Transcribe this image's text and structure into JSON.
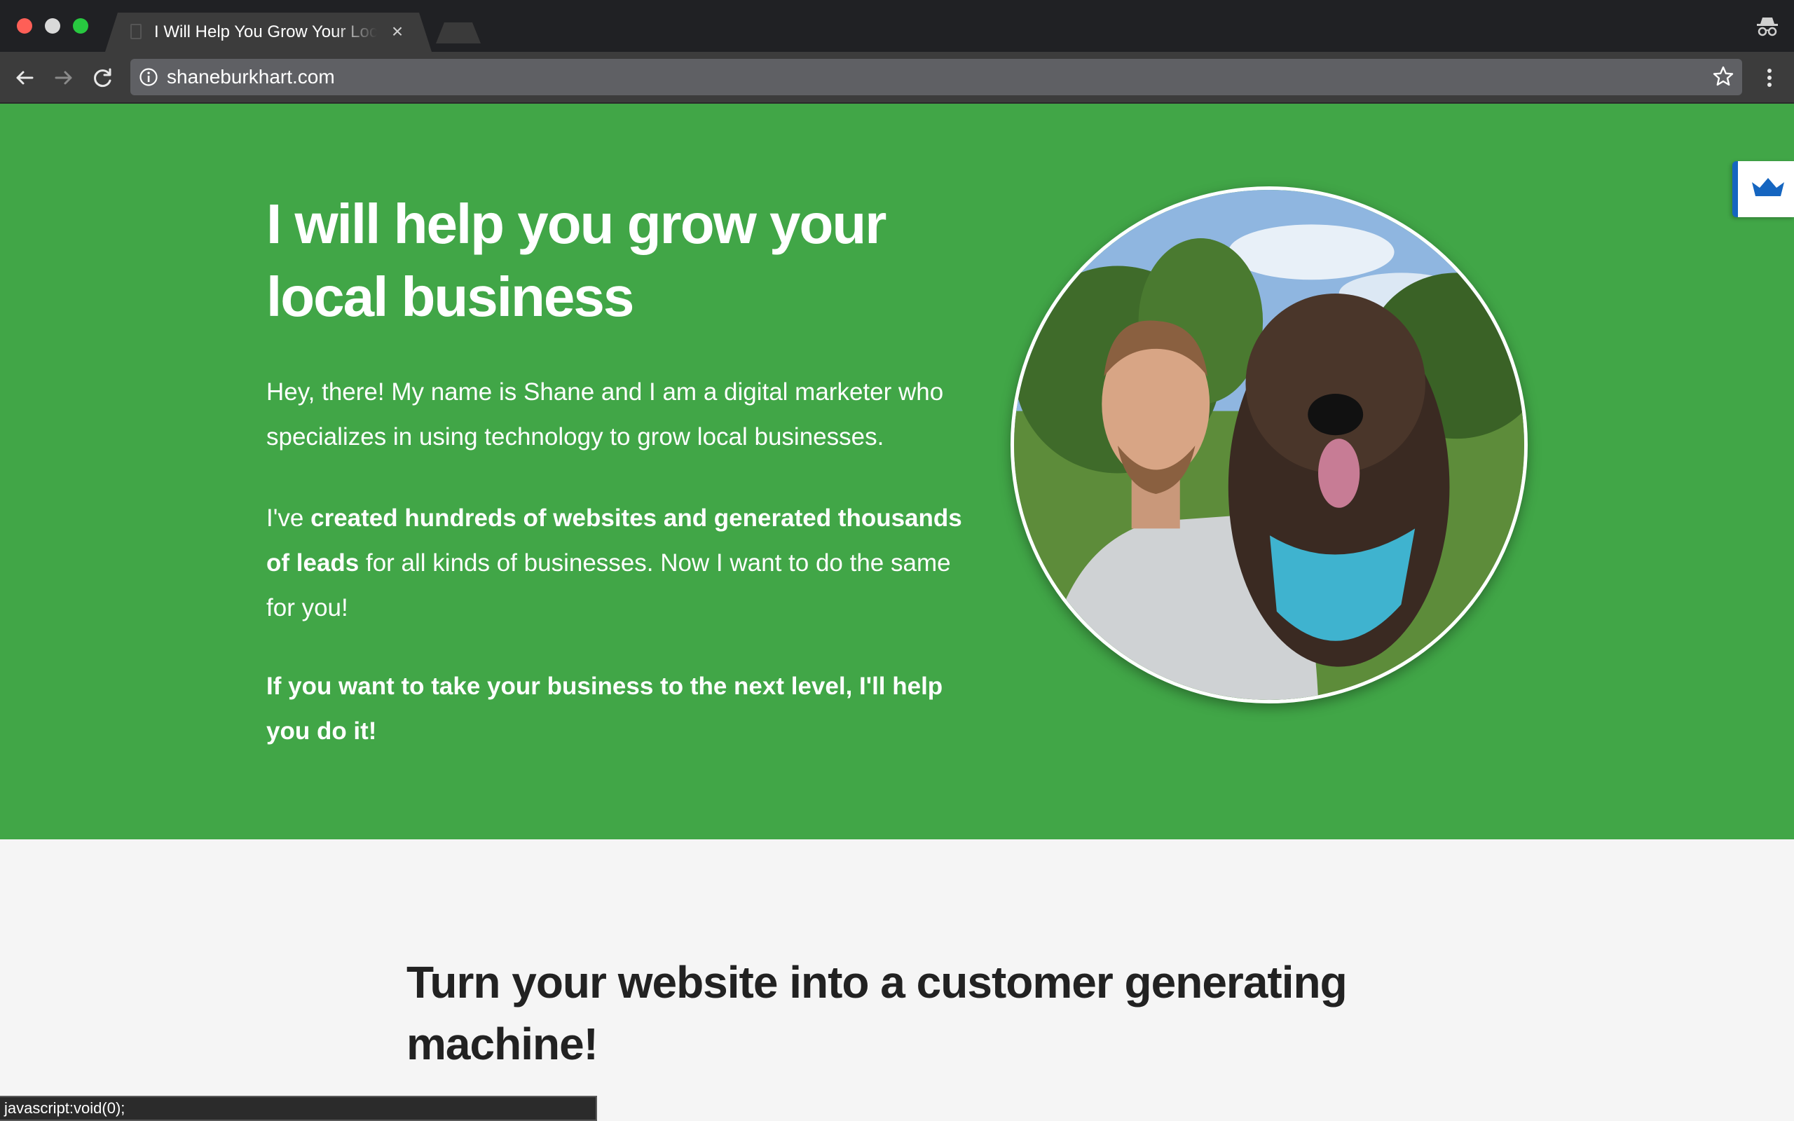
{
  "browser": {
    "tab_title": "I Will Help You Grow Your Local Business",
    "tab_close": "×",
    "url": "shaneburkhart.com",
    "status_text": "javascript:void(0);"
  },
  "hero": {
    "title_line1": "I will help you grow your",
    "title_line2": "local business",
    "intro": "Hey, there! My name is Shane and I am a digital marketer who specializes in using technology to grow local businesses.",
    "p2_pre": "I've ",
    "p2_bold": "created hundreds of websites and generated thousands of leads",
    "p2_post": " for all kinds of businesses. Now I want to do the same for you!",
    "cta": "If you want to take your business to the next level, I'll help you do it!"
  },
  "section2": {
    "title": "Turn your website into a customer generating machine!"
  },
  "colors": {
    "hero_bg": "#41a647",
    "page_bg": "#f5f5f5",
    "chrome_dark": "#202124",
    "accent_blue": "#1565c0"
  },
  "icons": [
    "back-arrow-icon",
    "forward-arrow-icon",
    "reload-icon",
    "info-icon",
    "star-icon",
    "menu-icon",
    "incognito-icon",
    "crown-icon"
  ]
}
